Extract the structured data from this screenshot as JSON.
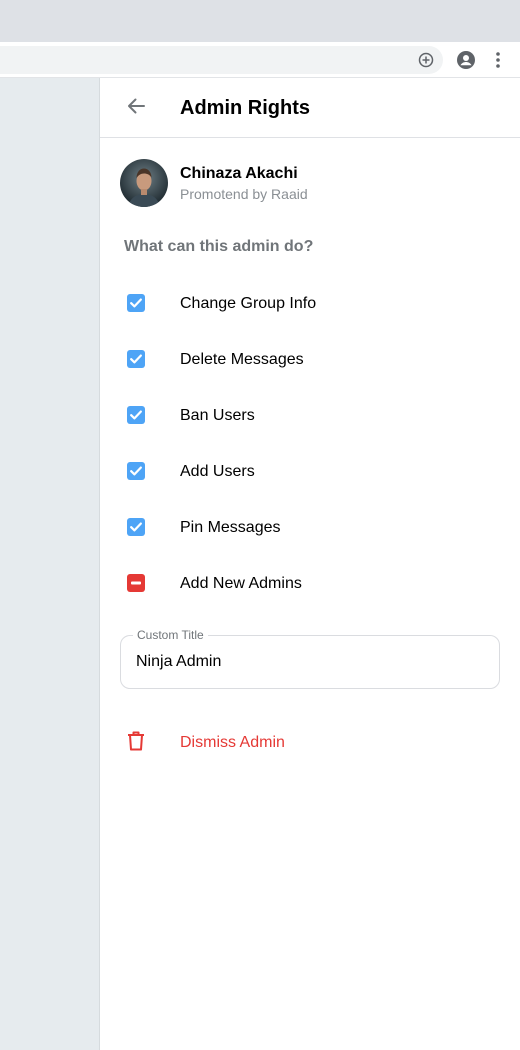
{
  "panel": {
    "title": "Admin Rights",
    "back_icon": "arrow-left-icon"
  },
  "profile": {
    "name": "Chinaza Akachi",
    "subtitle": "Promotend by Raaid"
  },
  "permissions": {
    "heading": "What can this admin do?",
    "items": [
      {
        "label": "Change Group Info",
        "state": "checked"
      },
      {
        "label": "Delete Messages",
        "state": "checked"
      },
      {
        "label": "Ban Users",
        "state": "checked"
      },
      {
        "label": "Add Users",
        "state": "checked"
      },
      {
        "label": "Pin Messages",
        "state": "checked"
      },
      {
        "label": "Add New Admins",
        "state": "denied"
      }
    ]
  },
  "custom_title": {
    "label": "Custom Title",
    "value": "Ninja Admin"
  },
  "dismiss": {
    "label": "Dismiss Admin",
    "icon": "trash-icon"
  },
  "colors": {
    "checked": "#4ea4f6",
    "danger": "#e53935",
    "muted_text": "#707579"
  },
  "browser": {
    "icons": [
      "add-circle-icon",
      "account-circle-icon",
      "more-vert-icon"
    ]
  }
}
